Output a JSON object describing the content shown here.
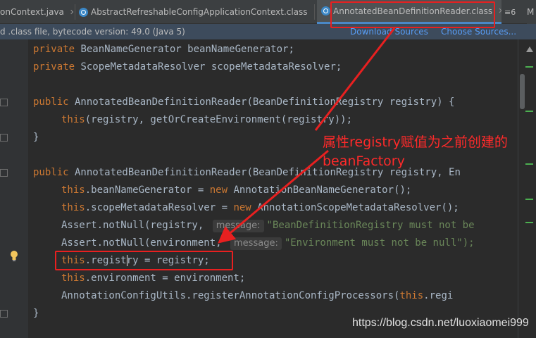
{
  "tabs": [
    {
      "label": "onContext.java",
      "active": false,
      "closable": true
    },
    {
      "label": "AbstractRefreshableConfigApplicationContext.class",
      "active": false,
      "closable": true
    },
    {
      "label": "AnnotatedBeanDefinitionReader.class",
      "active": true,
      "closable": true
    }
  ],
  "tab_overflow_label": "≡6",
  "tab_extra_label": "M",
  "infobar": {
    "message": "d .class file, bytecode version: 49.0 (Java 5)",
    "download_sources": "Download Sources",
    "choose_sources": "Choose Sources..."
  },
  "code": {
    "line1": {
      "kw": "private",
      "text": " BeanNameGenerator beanNameGenerator;"
    },
    "line2": {
      "kw": "private",
      "text": " ScopeMetadataResolver scopeMetadataResolver;"
    },
    "line3": {
      "kw": "public",
      "text": " AnnotatedBeanDefinitionReader(BeanDefinitionRegistry registry) {"
    },
    "line4": {
      "kw": "this",
      "text": "(registry, getOrCreateEnvironment(registry));"
    },
    "line5": {
      "text": "}"
    },
    "line6": {
      "kw": "public",
      "text": " AnnotatedBeanDefinitionReader(BeanDefinitionRegistry registry, En"
    },
    "line7": {
      "kw": "this",
      "text": ".beanNameGenerator = ",
      "kw2": "new",
      "text2": " AnnotationBeanNameGenerator();"
    },
    "line8": {
      "kw": "this",
      "text": ".scopeMetadataResolver = ",
      "kw2": "new",
      "text2": " AnnotationScopeMetadataResolver();"
    },
    "line9": {
      "text": "Assert.notNull(registry, ",
      "hint": "message:",
      "str": "\"BeanDefinitionRegistry must not be"
    },
    "line10": {
      "text": "Assert.notNull(environment, ",
      "hint": "message:",
      "str": "\"Environment must not be null\");"
    },
    "line11": {
      "kw": "this",
      "text_a": ".regist",
      "text_b": "ry = registry;"
    },
    "line12": {
      "kw": "this",
      "text": ".environment = environment;"
    },
    "line13": {
      "text": "AnnotationConfigUtils.registerAnnotationConfigProcessors(",
      "kw": "this",
      "text2": ".regi"
    },
    "line14": {
      "text": "}"
    }
  },
  "annotation": {
    "line1": "属性registry赋值为之前创建的",
    "line2": "beanFactory",
    "color": "#ff2a2a"
  },
  "watermark": "https://blog.csdn.net/luoxiaomei999"
}
